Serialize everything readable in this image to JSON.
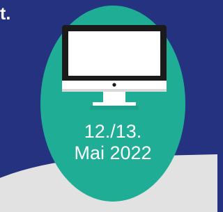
{
  "headline_fragment": "t.",
  "event_date": {
    "line1": "12./13.",
    "line2": "Mai 2022"
  },
  "colors": {
    "background": "#25327f",
    "badge": "#1fad96",
    "swoosh": "#e2e2e2",
    "text": "#ffffff"
  },
  "icon": "desktop-monitor-icon"
}
